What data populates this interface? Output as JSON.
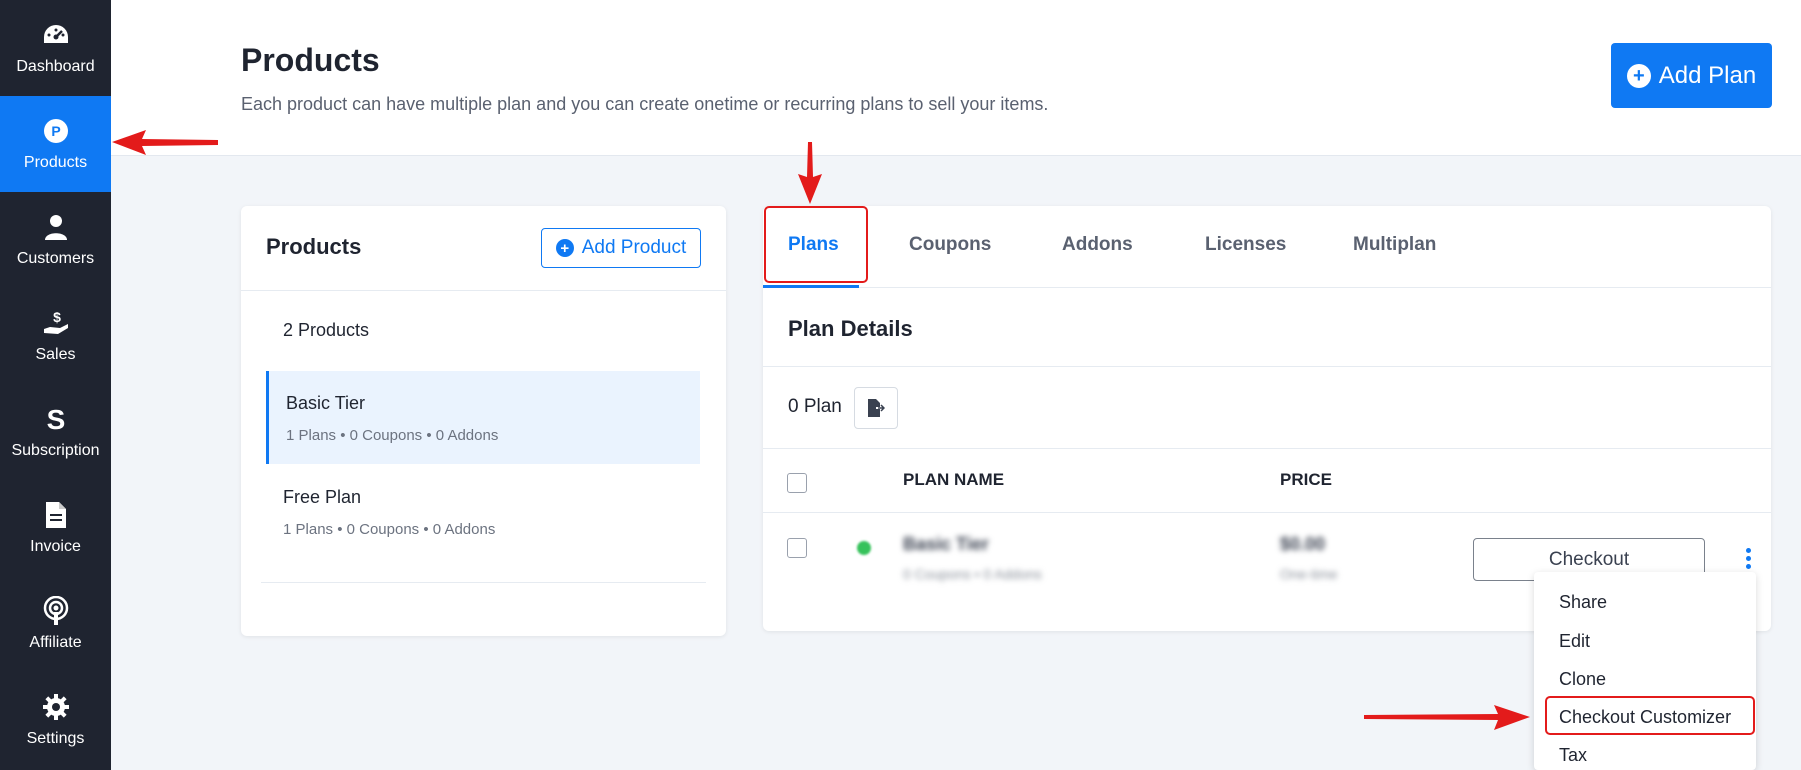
{
  "sidebar": {
    "items": [
      {
        "label": "Dashboard",
        "icon": "dashboard-gauge-icon"
      },
      {
        "label": "Products",
        "icon": "products-p-icon",
        "active": true
      },
      {
        "label": "Customers",
        "icon": "user-icon"
      },
      {
        "label": "Sales",
        "icon": "hand-dollar-icon"
      },
      {
        "label": "Subscription",
        "icon": "subscription-s-icon"
      },
      {
        "label": "Invoice",
        "icon": "document-icon"
      },
      {
        "label": "Affiliate",
        "icon": "broadcast-icon"
      },
      {
        "label": "Settings",
        "icon": "gear-icon"
      }
    ]
  },
  "header": {
    "title": "Products",
    "subtitle": "Each product can have multiple plan and you can create onetime or recurring plans to sell your items.",
    "add_plan_label": "Add Plan"
  },
  "products_panel": {
    "title": "Products",
    "add_product_label": "Add Product",
    "count_label": "2 Products",
    "items": [
      {
        "name": "Basic Tier",
        "meta": "1 Plans  • 0 Coupons  • 0 Addons",
        "selected": true
      },
      {
        "name": "Free Plan",
        "meta": "1 Plans  • 0 Coupons  • 0 Addons",
        "selected": false
      }
    ]
  },
  "plans_panel": {
    "tabs": [
      "Plans",
      "Coupons",
      "Addons",
      "Licenses",
      "Multiplan"
    ],
    "active_tab": "Plans",
    "section_title": "Plan Details",
    "plan_count": "0 Plan",
    "columns": {
      "name": "PLAN NAME",
      "price": "PRICE"
    },
    "row": {
      "name": "Basic Tier",
      "sub": "0 Coupons • 0 Addons",
      "price": "$0.00",
      "price_sub": "One-time",
      "checkout_label": "Checkout"
    }
  },
  "dropdown": {
    "items": [
      "Share",
      "Edit",
      "Clone",
      "Checkout Customizer",
      "Tax"
    ],
    "highlighted": "Checkout Customizer"
  },
  "colors": {
    "accent": "#0f79f3",
    "sidebar_bg": "#1f2430",
    "annotation_red": "#e31b1b",
    "status_active": "#36c25b"
  }
}
